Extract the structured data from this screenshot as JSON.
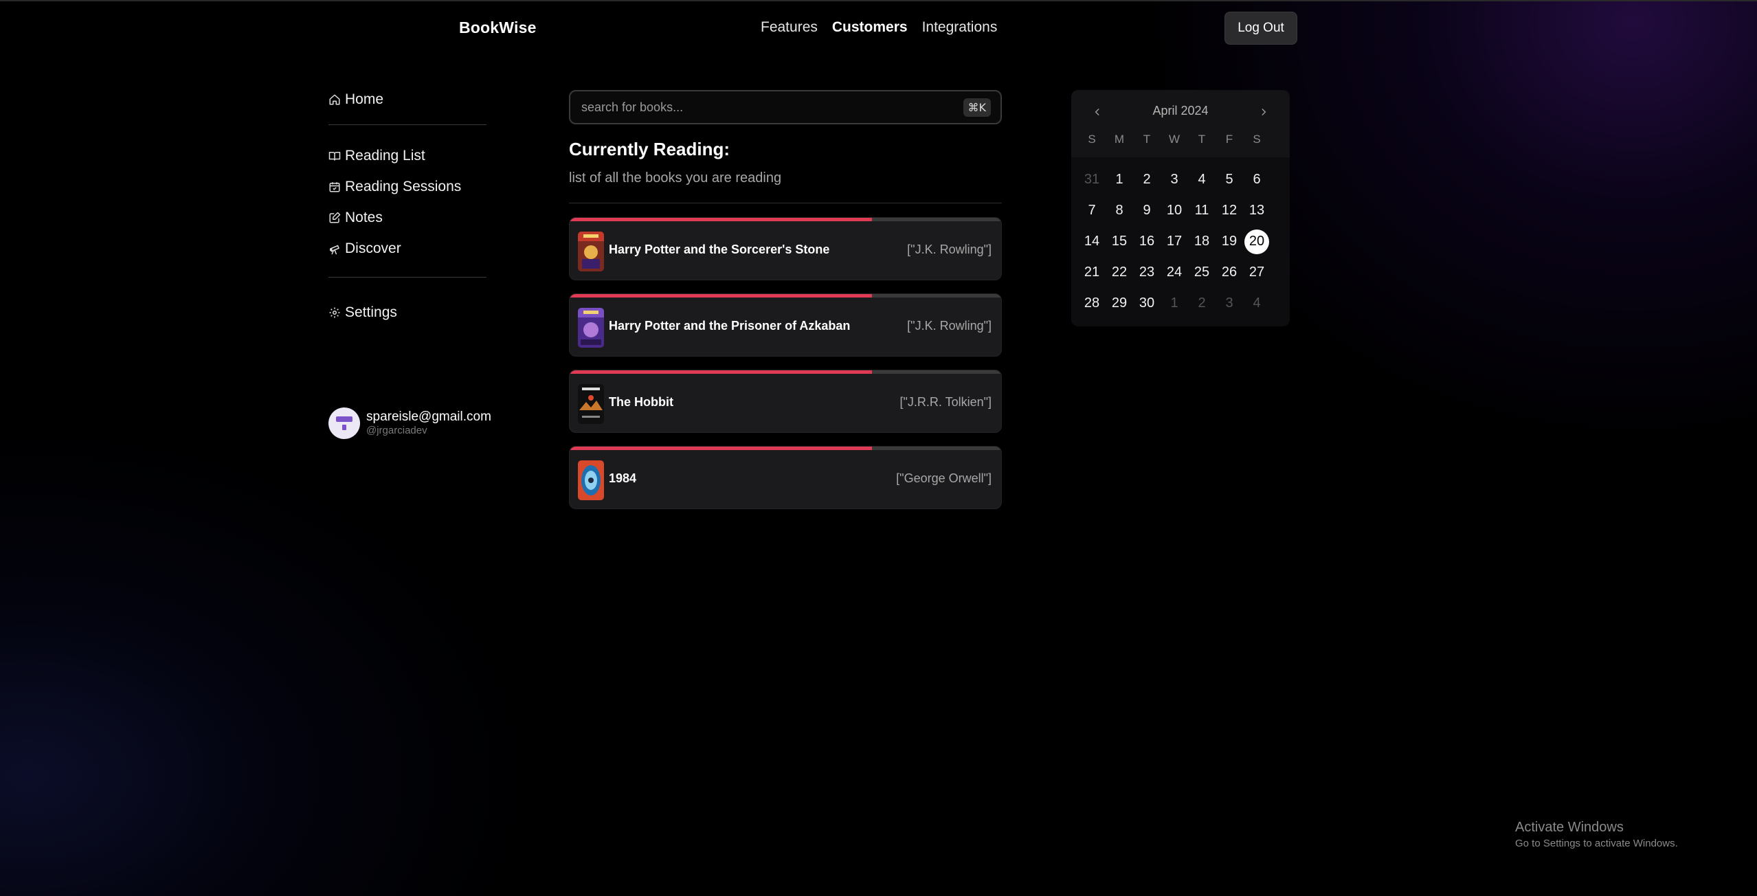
{
  "header": {
    "brand": "BookWise",
    "nav": [
      "Features",
      "Customers",
      "Integrations"
    ],
    "active_nav": "Customers",
    "logout_label": "Log Out"
  },
  "sidebar": {
    "home": "Home",
    "items": [
      {
        "label": "Reading List",
        "icon": "book-open-icon"
      },
      {
        "label": "Reading Sessions",
        "icon": "calendar-icon"
      },
      {
        "label": "Notes",
        "icon": "edit-note-icon"
      },
      {
        "label": "Discover",
        "icon": "telescope-icon"
      }
    ],
    "settings": "Settings"
  },
  "profile": {
    "email": "spareisle@gmail.com",
    "handle": "@jrgarciadev"
  },
  "search": {
    "placeholder": "search for books...",
    "shortcut": "⌘K"
  },
  "main": {
    "title": "Currently Reading:",
    "subtitle": "list of all the books you are reading"
  },
  "books": [
    {
      "title": "Harry Potter and the Sorcerer's Stone",
      "author": "[\"J.K. Rowling\"]",
      "progress": 0.7
    },
    {
      "title": "Harry Potter and the Prisoner of Azkaban",
      "author": "[\"J.K. Rowling\"]",
      "progress": 0.7
    },
    {
      "title": "The Hobbit",
      "author": "[\"J.R.R. Tolkien\"]",
      "progress": 0.7
    },
    {
      "title": "1984",
      "author": "[\"George Orwell\"]",
      "progress": 0.7
    }
  ],
  "calendar": {
    "month": "April 2024",
    "weekdays": [
      "S",
      "M",
      "T",
      "W",
      "T",
      "F",
      "S"
    ],
    "days": [
      {
        "d": "31",
        "muted": true
      },
      {
        "d": "1"
      },
      {
        "d": "2"
      },
      {
        "d": "3"
      },
      {
        "d": "4"
      },
      {
        "d": "5"
      },
      {
        "d": "6"
      },
      {
        "d": "7"
      },
      {
        "d": "8"
      },
      {
        "d": "9"
      },
      {
        "d": "10"
      },
      {
        "d": "11"
      },
      {
        "d": "12"
      },
      {
        "d": "13"
      },
      {
        "d": "14"
      },
      {
        "d": "15"
      },
      {
        "d": "16"
      },
      {
        "d": "17"
      },
      {
        "d": "18"
      },
      {
        "d": "19"
      },
      {
        "d": "20",
        "today": true
      },
      {
        "d": "21"
      },
      {
        "d": "22"
      },
      {
        "d": "23"
      },
      {
        "d": "24"
      },
      {
        "d": "25"
      },
      {
        "d": "26"
      },
      {
        "d": "27"
      },
      {
        "d": "28"
      },
      {
        "d": "29"
      },
      {
        "d": "30"
      },
      {
        "d": "1",
        "muted": true
      },
      {
        "d": "2",
        "muted": true
      },
      {
        "d": "3",
        "muted": true
      },
      {
        "d": "4",
        "muted": true
      }
    ]
  },
  "windows_notice": {
    "line1": "Activate Windows",
    "line2": "Go to Settings to activate Windows."
  },
  "colors": {
    "progress": "#e03a55",
    "accent_avatar": "#7a52c9"
  }
}
